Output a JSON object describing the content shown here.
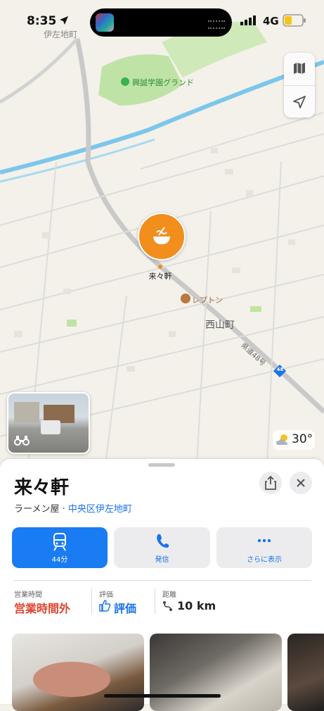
{
  "status_bar": {
    "time": "8:35",
    "network": "4G",
    "battery_color": "#f5c518"
  },
  "map": {
    "labels": {
      "area_top_left": "伊左地町",
      "park": "興誠学園グランド",
      "poi": "レプトン",
      "district": "西山町",
      "route_road": "県道48号",
      "route_shield": "48",
      "pin_name": "来々軒"
    },
    "icons": {
      "map_mode": "map-icon",
      "location": "location-arrow-icon",
      "pin": "ramen-bowl-icon",
      "lookaround": "binoculars-icon"
    },
    "weather": {
      "temperature": "30°",
      "icon": "partly-cloudy-icon"
    },
    "colors": {
      "land": "#f3f1ea",
      "water": "#7cc6ec",
      "park": "#bfe3a6",
      "road": "#c8c8c8",
      "pin": "#f28e1c"
    }
  },
  "sheet": {
    "title": "来々軒",
    "category": "ラーメン屋",
    "separator": "·",
    "location_link": "中央区伊左地町",
    "actions": [
      {
        "label": "44分",
        "icon": "train-icon"
      },
      {
        "label": "発信",
        "icon": "phone-icon"
      },
      {
        "label": "さらに表示",
        "icon": "more-icon"
      }
    ],
    "info": {
      "hours_header": "営業時間",
      "hours_value": "営業時間外",
      "rating_header": "評価",
      "rating_value": "評価",
      "distance_header": "距離",
      "distance_value": "10 km"
    },
    "accent_color": "#1a73e8",
    "closed_color": "#e0442f"
  }
}
